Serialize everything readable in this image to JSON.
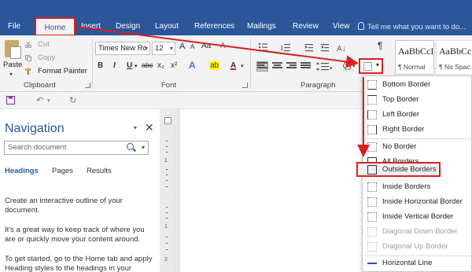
{
  "tabs": {
    "file": "File",
    "home": "Home",
    "insert": "Insert",
    "design": "Design",
    "layout": "Layout",
    "references": "References",
    "mailings": "Mailings",
    "review": "Review",
    "view": "View"
  },
  "tell_me": "Tell me what you want to do...",
  "clipboard": {
    "paste": "Paste",
    "cut": "Cut",
    "copy": "Copy",
    "format_painter": "Format Painter",
    "group_label": "Clipboard"
  },
  "font": {
    "name": "Times New Ro",
    "size": "12",
    "group_label": "Font",
    "bold": "B",
    "italic": "I",
    "underline": "U",
    "strike": "abc",
    "subscript": "x₂",
    "superscript": "x²",
    "text_effects": "A",
    "highlight": "ab",
    "font_color": "A",
    "grow": "A",
    "shrink": "A",
    "change_case": "Aa",
    "clear_format": "A"
  },
  "paragraph": {
    "group_label": "Paragraph",
    "show_marks": "¶"
  },
  "styles": {
    "normal_sample": "AaBbCcI",
    "normal_name": "¶ Normal",
    "nospacing_sample": "AaBbCc",
    "nospacing_name": "¶ No Spac..."
  },
  "navigation": {
    "title": "Navigation",
    "search_placeholder": "Search document",
    "tab_headings": "Headings",
    "tab_pages": "Pages",
    "tab_results": "Results",
    "para1": "Create an interactive outline of your document.",
    "para2": "It's a great way to keep track of where you are or quickly move your content around.",
    "para3": "To get started, go to the Home tab and apply Heading styles to the headings in your"
  },
  "ruler": {
    "n1": "1",
    "n2": "1",
    "n3": "2"
  },
  "border_menu": {
    "items": [
      {
        "label": "Bottom Border",
        "disabled": false
      },
      {
        "label": "Top Border",
        "disabled": false
      },
      {
        "label": "Left Border",
        "disabled": false
      },
      {
        "label": "Right Border",
        "disabled": false
      },
      {
        "label": "No Border",
        "disabled": false
      },
      {
        "label": "All Borders",
        "disabled": false
      },
      {
        "label": "Outside Borders",
        "disabled": false
      },
      {
        "label": "Inside Borders",
        "disabled": false
      },
      {
        "label": "Inside Horizontal Border",
        "disabled": false
      },
      {
        "label": "Inside Vertical Border",
        "disabled": false
      },
      {
        "label": "Diagonal Down Border",
        "disabled": true
      },
      {
        "label": "Diagonal Up Border",
        "disabled": true
      },
      {
        "label": "Horizontal Line",
        "disabled": false
      }
    ]
  },
  "colors": {
    "ribbon_blue": "#2b579a",
    "annotation_red": "#d9201f"
  }
}
